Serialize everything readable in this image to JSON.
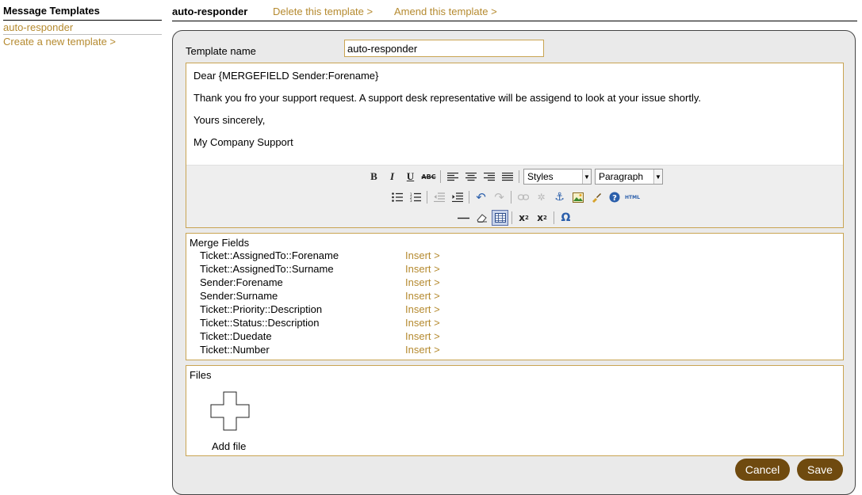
{
  "sidebar": {
    "title": "Message Templates",
    "items": [
      {
        "label": "auto-responder"
      },
      {
        "label": "Create a new template >"
      }
    ]
  },
  "header": {
    "title": "auto-responder",
    "delete_label": "Delete this template >",
    "amend_label": "Amend this template >"
  },
  "form": {
    "name_label": "Template name",
    "name_value": "auto-responder"
  },
  "editor": {
    "paragraphs": [
      "Dear {MERGEFIELD Sender:Forename}",
      "Thank you fro your support request. A support desk representative will be assigend to look at your issue shortly.",
      "Yours sincerely,",
      "My Company Support"
    ],
    "styles_value": "Styles",
    "format_value": "Paragraph"
  },
  "merge_fields": {
    "title": "Merge Fields",
    "insert_label": "Insert >",
    "items": [
      "Ticket::AssignedTo::Forename",
      "Ticket::AssignedTo::Surname",
      "Sender:Forename",
      "Sender:Surname",
      "Ticket::Priority::Description",
      "Ticket::Status::Description",
      "Ticket::Duedate",
      "Ticket::Number"
    ]
  },
  "files": {
    "title": "Files",
    "add_label": "Add file"
  },
  "buttons": {
    "cancel": "Cancel",
    "save": "Save"
  },
  "colors": {
    "link": "#b58a2f",
    "button_bg": "#6f4a0f",
    "field_border": "#c9a452",
    "panel_bg": "#eaeaea"
  }
}
